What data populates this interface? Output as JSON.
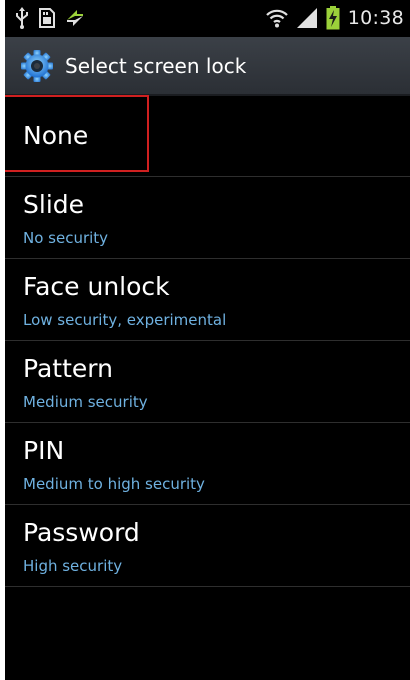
{
  "status_bar": {
    "time": "10:38",
    "left_icons": [
      "usb-icon",
      "sd-card-icon",
      "sync-arrows-icon"
    ],
    "right_icons": [
      "wifi-icon",
      "signal-icon",
      "battery-charging-icon"
    ]
  },
  "header": {
    "icon": "settings-gear-icon",
    "title": "Select screen lock"
  },
  "options": [
    {
      "label": "None",
      "subtitle": ""
    },
    {
      "label": "Slide",
      "subtitle": "No security"
    },
    {
      "label": "Face unlock",
      "subtitle": "Low security, experimental"
    },
    {
      "label": "Pattern",
      "subtitle": "Medium security"
    },
    {
      "label": "PIN",
      "subtitle": "Medium to high security"
    },
    {
      "label": "Password",
      "subtitle": "High security"
    }
  ],
  "colors": {
    "background": "#000000",
    "title_bar": "#33383e",
    "subtitle_text": "#6fb1e0",
    "highlight": "#d02020"
  }
}
